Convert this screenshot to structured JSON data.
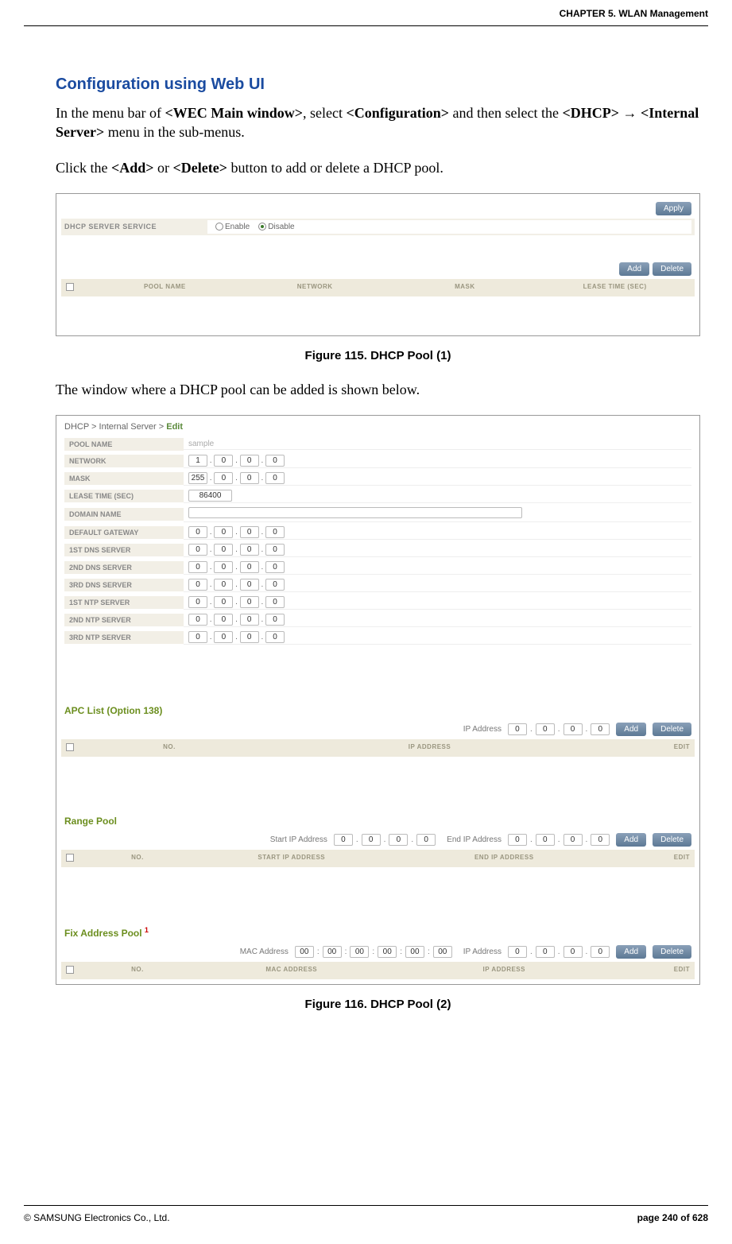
{
  "header": {
    "chapter": "CHAPTER 5. WLAN Management"
  },
  "section": {
    "title": "Configuration using Web UI"
  },
  "para1": {
    "pre": "In the menu bar of ",
    "b1": "<WEC Main window>",
    "mid1": ", select ",
    "b2": "<Configuration>",
    "mid2": " and then select the ",
    "b3": "<DHCP>",
    "arrow": " → ",
    "b4": "<Internal Server>",
    "post": " menu in the sub-menus."
  },
  "para2": {
    "pre": "Click the ",
    "b1": "<Add>",
    "mid": " or ",
    "b2": "<Delete>",
    "post": " button to add or delete a DHCP pool."
  },
  "fig1": {
    "btn_apply": "Apply",
    "service_label": "DHCP SERVER SERVICE",
    "enable": "Enable",
    "disable": "Disable",
    "btn_add": "Add",
    "btn_del": "Delete",
    "headers": [
      "POOL NAME",
      "NETWORK",
      "MASK",
      "LEASE TIME (SEC)"
    ],
    "caption": "Figure 115. DHCP Pool (1)"
  },
  "para3": "The window where a DHCP pool can be added is shown below.",
  "fig2": {
    "breadcrumb": {
      "a": "DHCP",
      "b": "Internal Server",
      "c": "Edit",
      "sep": "  >  "
    },
    "rows": {
      "pool_name": {
        "label": "POOL NAME",
        "value": "sample"
      },
      "network": {
        "label": "NETWORK",
        "ip": [
          "1",
          "0",
          "0",
          "0"
        ]
      },
      "mask": {
        "label": "MASK",
        "ip": [
          "255",
          "0",
          "0",
          "0"
        ]
      },
      "lease": {
        "label": "LEASE TIME (SEC)",
        "value": "86400"
      },
      "domain": {
        "label": "DOMAIN NAME",
        "value": ""
      },
      "gateway": {
        "label": "DEFAULT GATEWAY",
        "ip": [
          "0",
          "0",
          "0",
          "0"
        ]
      },
      "dns1": {
        "label": "1ST DNS SERVER",
        "ip": [
          "0",
          "0",
          "0",
          "0"
        ]
      },
      "dns2": {
        "label": "2ND DNS SERVER",
        "ip": [
          "0",
          "0",
          "0",
          "0"
        ]
      },
      "dns3": {
        "label": "3RD DNS SERVER",
        "ip": [
          "0",
          "0",
          "0",
          "0"
        ]
      },
      "ntp1": {
        "label": "1ST NTP SERVER",
        "ip": [
          "0",
          "0",
          "0",
          "0"
        ]
      },
      "ntp2": {
        "label": "2ND NTP SERVER",
        "ip": [
          "0",
          "0",
          "0",
          "0"
        ]
      },
      "ntp3": {
        "label": "3RD NTP SERVER",
        "ip": [
          "0",
          "0",
          "0",
          "0"
        ]
      }
    },
    "apc": {
      "title": "APC List (Option 138)",
      "ip_label": "IP Address",
      "ip": [
        "0",
        "0",
        "0",
        "0"
      ],
      "add": "Add",
      "del": "Delete",
      "headers": [
        "NO.",
        "IP ADDRESS",
        "EDIT"
      ]
    },
    "range": {
      "title": "Range Pool",
      "start_label": "Start IP Address",
      "end_label": "End IP Address",
      "start_ip": [
        "0",
        "0",
        "0",
        "0"
      ],
      "end_ip": [
        "0",
        "0",
        "0",
        "0"
      ],
      "add": "Add",
      "del": "Delete",
      "headers": [
        "NO.",
        "START IP ADDRESS",
        "END IP ADDRESS",
        "EDIT"
      ]
    },
    "fix": {
      "title": "Fix Address Pool",
      "sup": "1",
      "mac_label": "MAC Address",
      "ip_label": "IP Address",
      "mac": [
        "00",
        "00",
        "00",
        "00",
        "00",
        "00"
      ],
      "ip": [
        "0",
        "0",
        "0",
        "0"
      ],
      "add": "Add",
      "del": "Delete",
      "headers": [
        "NO.",
        "MAC ADDRESS",
        "IP ADDRESS",
        "EDIT"
      ]
    },
    "caption": "Figure 116. DHCP Pool (2)"
  },
  "footer": {
    "left": "© SAMSUNG Electronics Co., Ltd.",
    "right": "page 240 of 628"
  }
}
